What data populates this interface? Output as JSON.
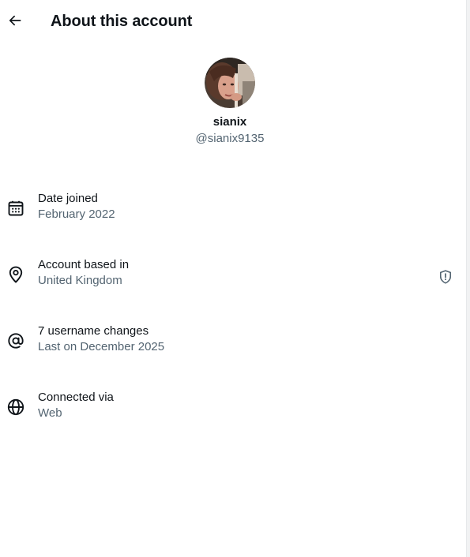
{
  "header": {
    "title": "About this account",
    "back_icon": "arrow-left-icon"
  },
  "profile": {
    "display_name": "sianix",
    "handle": "@sianix9135"
  },
  "info": {
    "date_joined": {
      "label": "Date joined",
      "value": "February 2022",
      "icon": "calendar-icon"
    },
    "account_based_in": {
      "label": "Account based in",
      "value": "United Kingdom",
      "icon": "location-pin-icon",
      "trailing_icon": "shield-alert-icon"
    },
    "username_changes": {
      "label": "7 username changes",
      "value": "Last on December 2025",
      "icon": "at-sign-icon"
    },
    "connected_via": {
      "label": "Connected via",
      "value": "Web",
      "icon": "globe-icon"
    }
  },
  "colors": {
    "primary_text": "#0f1419",
    "secondary_text": "#536471",
    "background": "#ffffff"
  }
}
